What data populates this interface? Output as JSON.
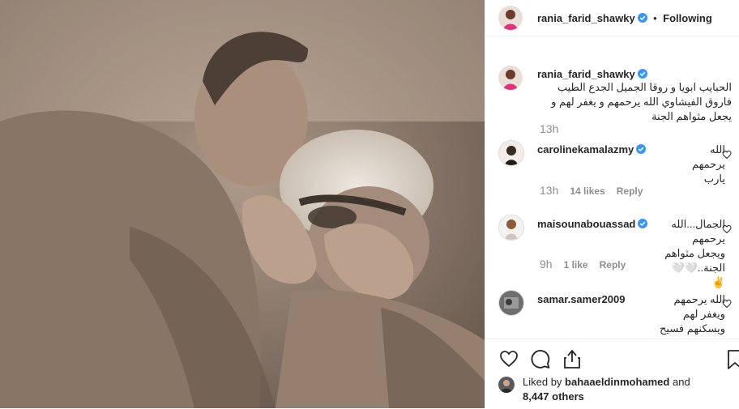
{
  "post": {
    "author": "rania_farid_shawky",
    "follow_status": "Following",
    "separator": "•"
  },
  "caption": {
    "user": "rania_farid_shawky",
    "text": "الحبايب ابويا و روقا الجميل الجدع الطيب فاروق الفيشاوي الله يرحمهم و يغفر لهم و يجعل مثواهم الجنة",
    "time": "13h"
  },
  "comments": [
    {
      "user": "carolinekamalazmy",
      "text": "الله يرحمهم يارب",
      "time": "13h",
      "likes": "14 likes",
      "reply": "Reply",
      "verified": true
    },
    {
      "user": "maisounabouassad",
      "text": "الجمال...الله يرحمهم ويجعل مثواهم الجنة..🤍🤍 ✌",
      "time": "9h",
      "likes": "1 like",
      "reply": "Reply",
      "verified": true
    },
    {
      "user": "samar.samer2009",
      "text": "الله يرحمهم ويغفر لهم ويسكنهم فسيح جناته",
      "time": "",
      "likes": "",
      "reply": "",
      "verified": false
    }
  ],
  "liked_by": {
    "prefix": "Liked by",
    "user": "bahaaeldinmohamed",
    "and": "and",
    "others": "8,447 others"
  },
  "icons": {
    "like": "heart-icon",
    "comment": "comment-icon",
    "share": "share-icon",
    "save": "bookmark-icon",
    "verified": "verified-badge-icon"
  },
  "colors": {
    "verified": "#3897f0",
    "muted": "#8e8e8e",
    "text": "#262626"
  }
}
